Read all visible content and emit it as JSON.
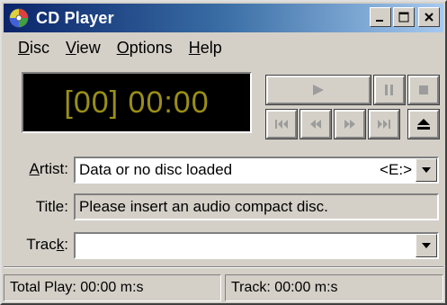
{
  "window": {
    "title": "CD Player"
  },
  "menu": {
    "items": [
      {
        "label_ul": "D",
        "label_rest": "isc"
      },
      {
        "label_ul": "V",
        "label_rest": "iew"
      },
      {
        "label_ul": "O",
        "label_rest": "ptions"
      },
      {
        "label_ul": "H",
        "label_rest": "elp"
      }
    ]
  },
  "display": {
    "time": "[00] 00:00"
  },
  "artist": {
    "label_ul": "A",
    "label_rest": "rtist:",
    "value": "Data or no disc loaded",
    "drive": "<E:>"
  },
  "title": {
    "label": "Title:",
    "value": "Please insert an audio compact disc."
  },
  "track": {
    "label_pre": "Trac",
    "label_ul": "k",
    "label_post": ":",
    "value": ""
  },
  "status": {
    "total_play": "Total Play: 00:00 m:s",
    "track": "Track: 00:00 m:s"
  },
  "colors": {
    "display_text": "#9a8f18",
    "display_bg": "#000000",
    "titlebar_start": "#0a246a"
  },
  "icons": {
    "app": "cd-disc-icon",
    "play": "play-icon",
    "pause": "pause-icon",
    "stop": "stop-icon",
    "prev_track": "previous-track-icon",
    "skip_back": "skip-backward-icon",
    "skip_forward": "skip-forward-icon",
    "next_track": "next-track-icon",
    "eject": "eject-icon"
  }
}
